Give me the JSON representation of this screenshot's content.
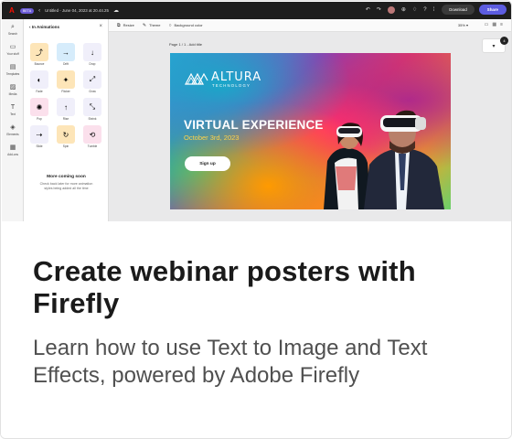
{
  "topbar": {
    "logo_icon": "adobe-express-logo",
    "beta": "BETA",
    "title": "Untitled - June 04, 2023 at 20.44.25",
    "download": "Download",
    "share": "Share"
  },
  "rail": [
    {
      "label": "Search",
      "icon": "⌕"
    },
    {
      "label": "Your stuff",
      "icon": "▭"
    },
    {
      "label": "Templates",
      "icon": "▤"
    },
    {
      "label": "Media",
      "icon": "▨"
    },
    {
      "label": "Text",
      "icon": "T"
    },
    {
      "label": "Elements",
      "icon": "◈"
    },
    {
      "label": "Add-ons",
      "icon": "▦"
    }
  ],
  "panel": {
    "title": "In Animations",
    "animations": [
      {
        "label": "Bounce",
        "icon": "⤴"
      },
      {
        "label": "Drift",
        "icon": "→"
      },
      {
        "label": "Drop",
        "icon": "↓"
      },
      {
        "label": "Fade",
        "icon": "◐"
      },
      {
        "label": "Flicker",
        "icon": "✦"
      },
      {
        "label": "Grow",
        "icon": "⤢"
      },
      {
        "label": "Pop",
        "icon": "✺"
      },
      {
        "label": "Rise",
        "icon": "↑"
      },
      {
        "label": "Shrink",
        "icon": "⤡"
      },
      {
        "label": "Slide",
        "icon": "⇢"
      },
      {
        "label": "Spin",
        "icon": "↻"
      },
      {
        "label": "Tumble",
        "icon": "⟲"
      }
    ],
    "more_title": "More coming soon",
    "more_sub": "Check back later for more animation styles being added all the time"
  },
  "canvasbar": {
    "resize": "Resize",
    "theme": "Theme",
    "bg": "Background color",
    "zoom": "35% ▾"
  },
  "page_label": "Page 1 / 1 - Add title",
  "poster": {
    "brand": "ALTURA",
    "brand_sub": "TECHNOLOGY",
    "headline": "VIRTUAL EXPERIENCE",
    "date": "October 3rd, 2023",
    "signup": "Sign up"
  },
  "caption": {
    "title": "Create webinar posters with Firefly",
    "description": "Learn how to use Text to Image and Text Effects, powered by Adobe Firefly"
  }
}
